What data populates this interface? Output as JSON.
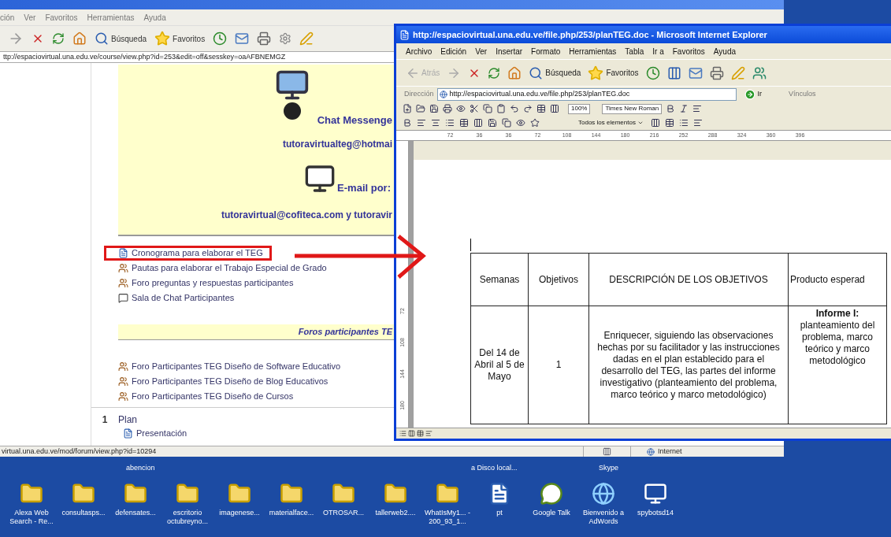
{
  "left_window": {
    "menu": [
      "ción",
      "Ver",
      "Favoritos",
      "Herramientas",
      "Ayuda"
    ],
    "toolbar": {
      "search_label": "Búsqueda",
      "favorites_label": "Favoritos"
    },
    "address": "ttp://espaciovirtual.una.edu.ve/course/view.php?id=253&edit=off&sesskey=oaAFBNEMGZ",
    "course": {
      "contact_box": {
        "messenger_label": "Chat Messenge",
        "messenger_email": "tutoravirtualteg@hotmai",
        "email_label": "E-mail por:",
        "emails": "tutoravirtual@cofiteca.com y tutoravir"
      },
      "links": [
        {
          "kind": "document",
          "text": "Cronograma para elaborar el TEG",
          "highlighted": true
        },
        {
          "kind": "forum",
          "text": "Pautas para elaborar el Trabajo Especial de Grado",
          "highlighted": false
        },
        {
          "kind": "forum",
          "text": "Foro preguntas y respuestas participantes",
          "highlighted": false
        },
        {
          "kind": "chat",
          "text": "Sala de Chat Participantes",
          "highlighted": false
        }
      ],
      "section_banner": "Foros participantes TE",
      "forum_links": [
        {
          "kind": "forum",
          "text": "Foro Participantes TEG Diseño de Software Educativo"
        },
        {
          "kind": "forum",
          "text": "Foro Participantes TEG Diseño de Blog Educativos"
        },
        {
          "kind": "forum",
          "text": "Foro Participantes TEG Diseño de Cursos"
        }
      ],
      "section": {
        "number": "1",
        "title": "Plan",
        "items": [
          {
            "kind": "document",
            "text": "Presentación"
          }
        ]
      }
    },
    "status_bar": {
      "url": "virtual.una.edu.ve/mod/forum/view.php?id=10294",
      "zone": "Internet"
    }
  },
  "right_window": {
    "title": "http://espaciovirtual.una.edu.ve/file.php/253/planTEG.doc - Microsoft Internet Explorer",
    "menu": [
      "Archivo",
      "Edición",
      "Ver",
      "Insertar",
      "Formato",
      "Herramientas",
      "Tabla",
      "Ir a",
      "Favoritos",
      "Ayuda"
    ],
    "toolbar": {
      "back_label": "Atrás",
      "search_label": "Búsqueda",
      "favorites_label": "Favoritos"
    },
    "address": {
      "label": "Dirección",
      "url": "http://espaciovirtual.una.edu.ve/file.php/253/planTEG.doc",
      "go_label": "Ir",
      "links_label": "Vínculos"
    },
    "word_toolbar": {
      "zoom": "100%",
      "font": "Times New Roman",
      "style_filter": "Todos los elementos"
    },
    "ruler": [
      "72",
      "36",
      "36",
      "72",
      "108",
      "144",
      "180",
      "216",
      "252",
      "288",
      "324",
      "360",
      "396"
    ],
    "vertical_ruler": [
      "72",
      "108",
      "144",
      "180"
    ],
    "table": {
      "columns": [
        "Semanas",
        "Objetivos",
        "DESCRIPCIÓN DE LOS OBJETIVOS",
        "Producto esperad"
      ],
      "rows": [
        [
          "Del 14 de Abril al 5 de Mayo",
          "1",
          "Enriquecer, siguiendo las observaciones hechas por su facilitador y las instrucciones dadas en el plan establecido para el desarrollo del TEG, las partes del informe investigativo (planteamiento del problema, marco teórico y marco metodológico)",
          "**Informe I:**\nplanteamiento del problema, marco teórico y marco metodológico"
        ]
      ]
    }
  },
  "desktop": {
    "partial_labels": [
      {
        "text": "abencion"
      },
      {
        "text": "a Disco local..."
      },
      {
        "text": "Skype"
      }
    ],
    "icons": [
      {
        "kind": "folder",
        "label": "Alexa Web Search - Re..."
      },
      {
        "kind": "folder",
        "label": "consultasps..."
      },
      {
        "kind": "folder",
        "label": "defensates..."
      },
      {
        "kind": "folder",
        "label": "escritorio octubreyno..."
      },
      {
        "kind": "folder",
        "label": "imagenese..."
      },
      {
        "kind": "folder",
        "label": "materialface..."
      },
      {
        "kind": "folder",
        "label": "OTROSAR..."
      },
      {
        "kind": "folder",
        "label": "tallerweb2...."
      },
      {
        "kind": "folder",
        "label": "WhatIsMy1... - 200_93_1..."
      },
      {
        "kind": "document",
        "label": "pt"
      },
      {
        "kind": "chat",
        "label": "Google Talk"
      },
      {
        "kind": "browser",
        "label": "Bienvenido a AdWords"
      },
      {
        "kind": "program",
        "label": "spybotsd14"
      }
    ]
  }
}
